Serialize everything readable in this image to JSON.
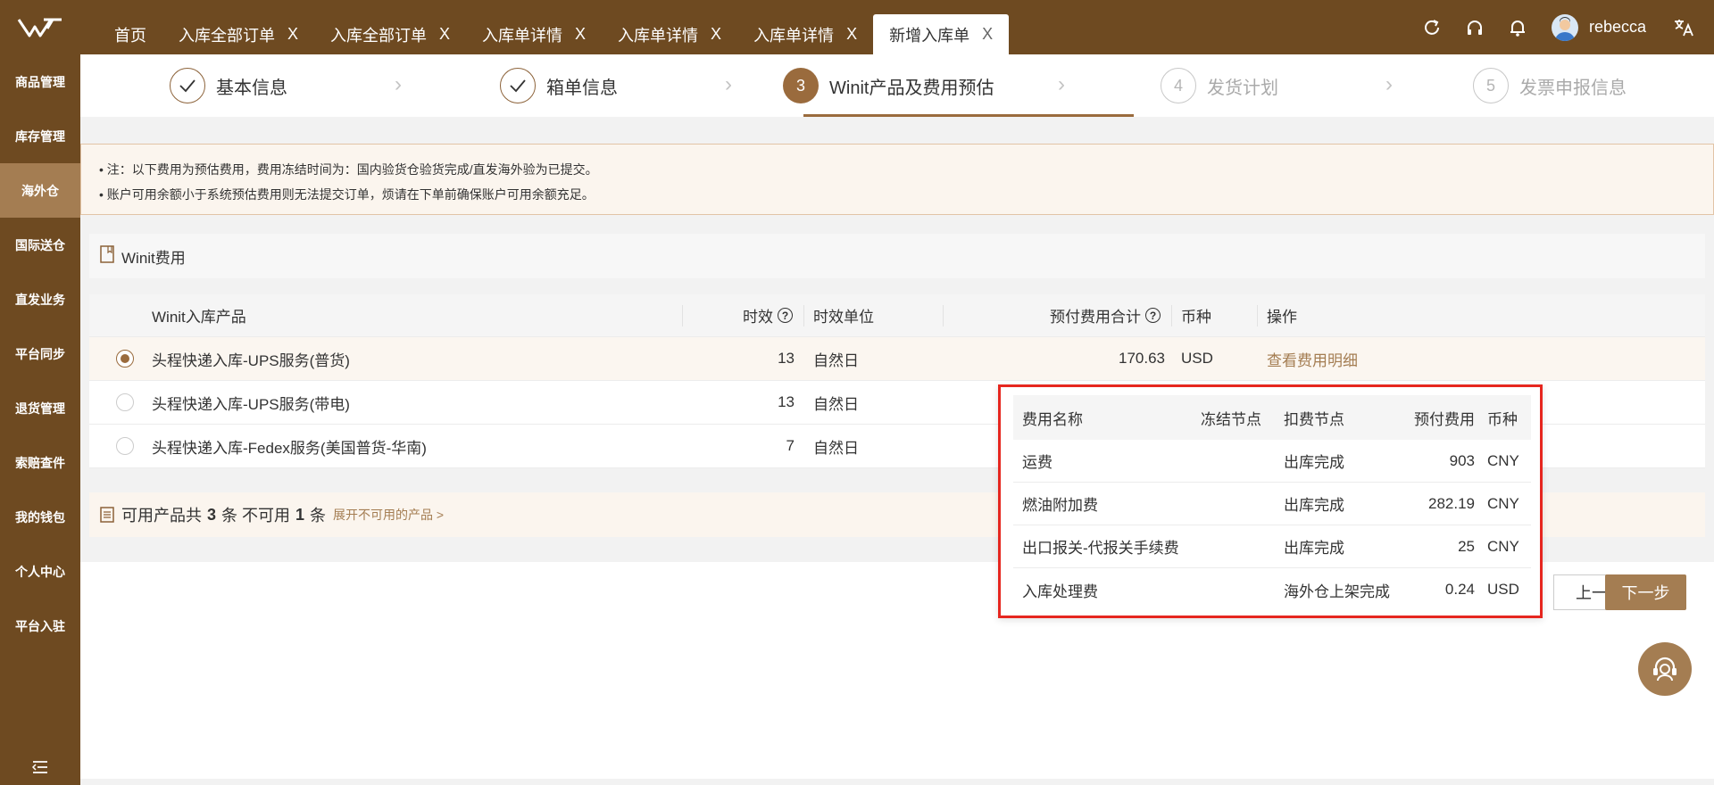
{
  "topbar": {
    "tabs": [
      {
        "label": "首页",
        "closable": false,
        "active": false
      },
      {
        "label": "入库全部订单",
        "closable": true,
        "active": false
      },
      {
        "label": "入库全部订单",
        "closable": true,
        "active": false
      },
      {
        "label": "入库单详情",
        "closable": true,
        "active": false
      },
      {
        "label": "入库单详情",
        "closable": true,
        "active": false
      },
      {
        "label": "入库单详情",
        "closable": true,
        "active": false
      },
      {
        "label": "新增入库单",
        "closable": true,
        "active": true
      }
    ],
    "close_glyph": "X",
    "icons": [
      "refresh-icon",
      "headset-icon",
      "bell-icon",
      "translate-icon"
    ],
    "username": "rebecca"
  },
  "sidebar": {
    "items": [
      {
        "label": "商品管理",
        "active": false
      },
      {
        "label": "库存管理",
        "active": false
      },
      {
        "label": "海外仓",
        "active": true
      },
      {
        "label": "国际送仓",
        "active": false
      },
      {
        "label": "直发业务",
        "active": false
      },
      {
        "label": "平台同步",
        "active": false
      },
      {
        "label": "退货管理",
        "active": false
      },
      {
        "label": "索赔查件",
        "active": false
      },
      {
        "label": "我的钱包",
        "active": false
      },
      {
        "label": "个人中心",
        "active": false
      },
      {
        "label": "平台入驻",
        "active": false
      }
    ]
  },
  "steps": [
    {
      "num": "",
      "label": "基本信息",
      "state": "done"
    },
    {
      "num": "",
      "label": "箱单信息",
      "state": "done"
    },
    {
      "num": "3",
      "label": "Winit产品及费用预估",
      "state": "current"
    },
    {
      "num": "4",
      "label": "发货计划",
      "state": "todo"
    },
    {
      "num": "5",
      "label": "发票申报信息",
      "state": "todo"
    }
  ],
  "notice": {
    "lines": [
      "• 注：以下费用为预估费用，费用冻结时间为：国内验货仓验货完成/直发海外验为已提交。",
      "• 账户可用余额小于系统预估费用则无法提交订单，烦请在下单前确保账户可用余额充足。"
    ]
  },
  "section": {
    "title": "Winit费用"
  },
  "products": {
    "headers": {
      "product": "Winit入库产品",
      "timeliness": "时效",
      "unit": "时效单位",
      "total": "预付费用合计",
      "currency": "币种",
      "action": "操作"
    },
    "rows": [
      {
        "name": "头程快递入库-UPS服务(普货)",
        "timeliness": "13",
        "unit": "自然日",
        "total": "170.63",
        "currency": "USD",
        "action": "查看费用明细",
        "selected": true
      },
      {
        "name": "头程快递入库-UPS服务(带电)",
        "timeliness": "13",
        "unit": "自然日",
        "total": "",
        "currency": "",
        "action": "",
        "selected": false
      },
      {
        "name": "头程快递入库-Fedex服务(美国普货-华南)",
        "timeliness": "7",
        "unit": "自然日",
        "total": "",
        "currency": "",
        "action": "",
        "selected": false
      }
    ]
  },
  "availability": {
    "prefix": "可用产品共",
    "available": "3",
    "middle": "条 不可用",
    "unavailable": "1",
    "suffix": "条",
    "expand_link": "展开不可用的产品 >"
  },
  "buttons": {
    "prev": "上一步",
    "next": "下一步"
  },
  "fee_popup": {
    "headers": {
      "name": "费用名称",
      "freeze": "冻结节点",
      "deduct": "扣费节点",
      "amount": "预付费用",
      "currency": "币种"
    },
    "rows": [
      {
        "name": "运费",
        "freeze": "",
        "deduct": "出库完成",
        "amount": "903",
        "currency": "CNY"
      },
      {
        "name": "燃油附加费",
        "freeze": "",
        "deduct": "出库完成",
        "amount": "282.19",
        "currency": "CNY"
      },
      {
        "name": "出口报关-代报关手续费",
        "freeze": "",
        "deduct": "出库完成",
        "amount": "25",
        "currency": "CNY"
      },
      {
        "name": "入库处理费",
        "freeze": "",
        "deduct": "海外仓上架完成",
        "amount": "0.24",
        "currency": "USD"
      }
    ]
  },
  "colors": {
    "brand": "#6e4a21",
    "accent": "#a47d52",
    "highlight_border": "#e6261f"
  }
}
